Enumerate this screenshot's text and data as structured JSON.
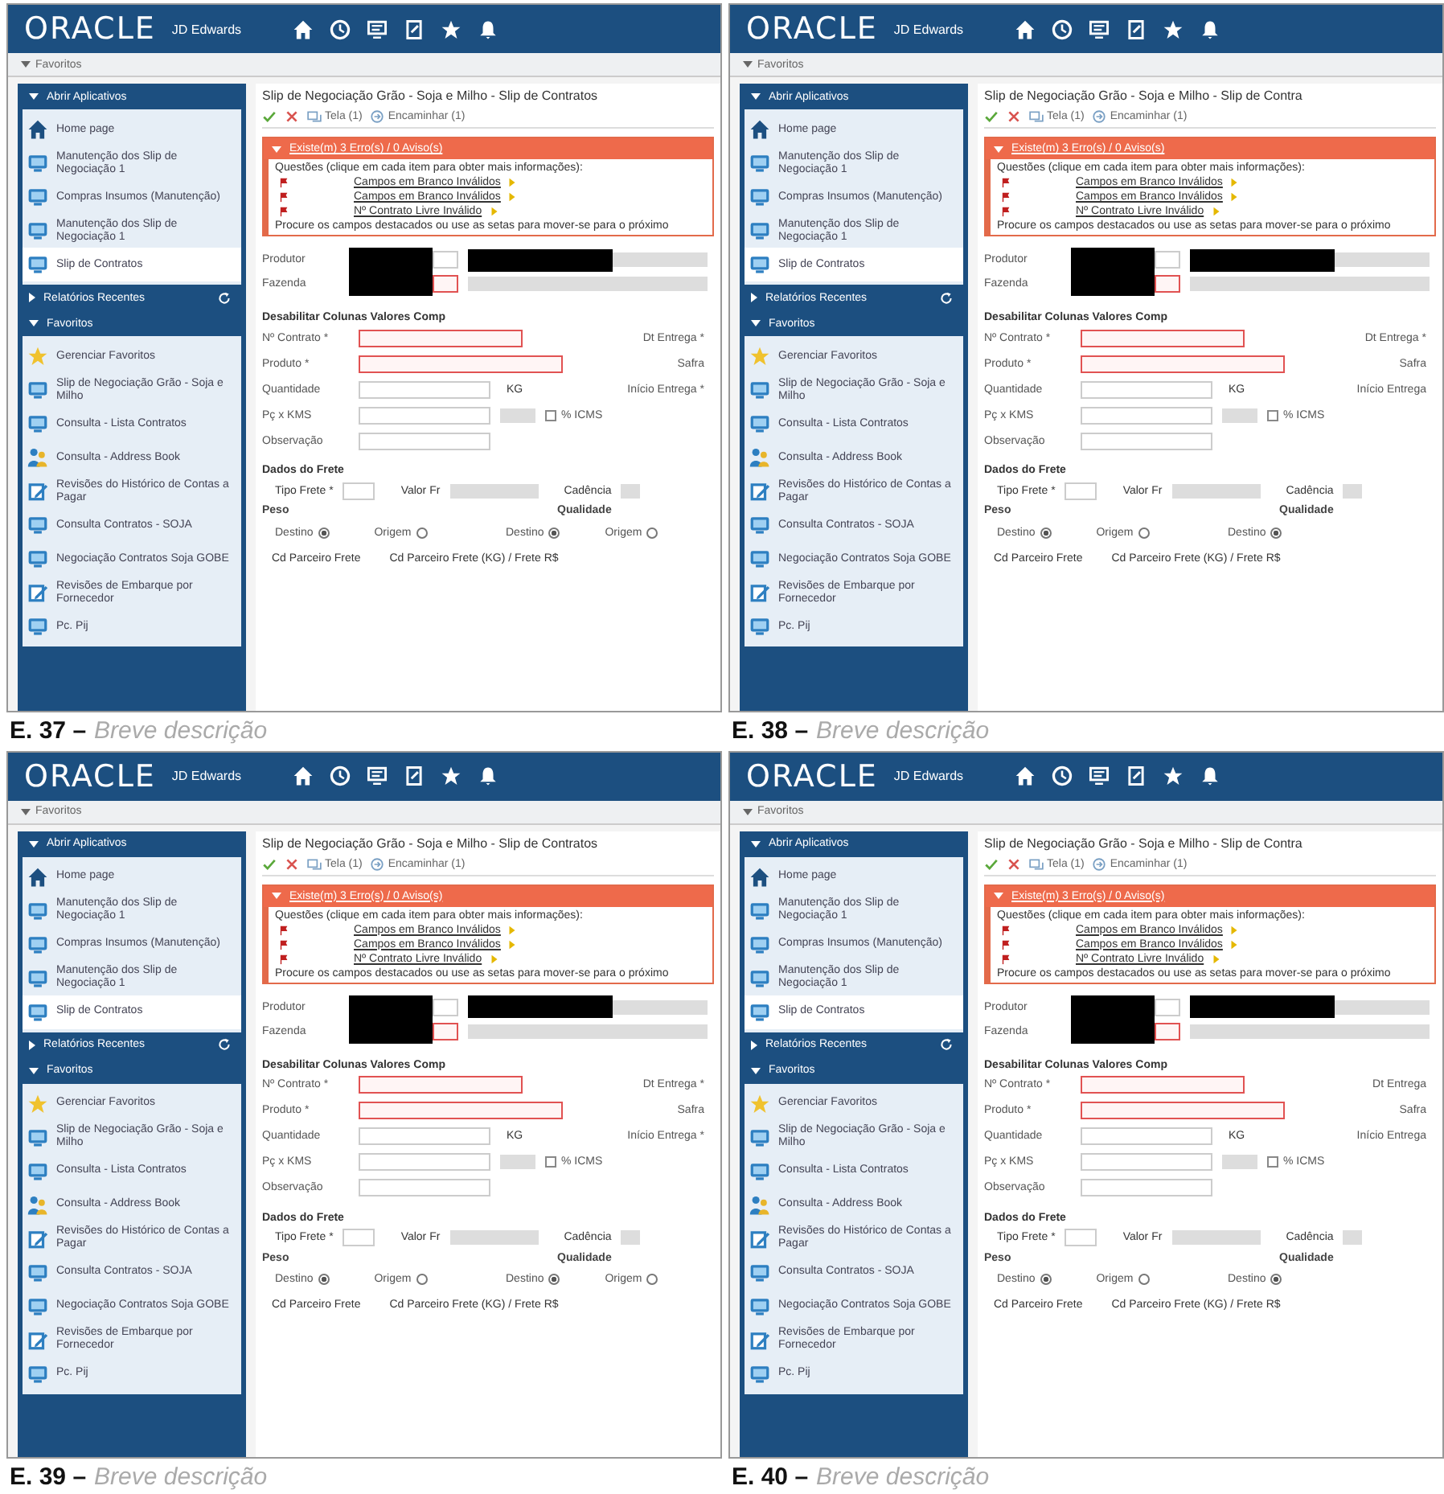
{
  "panels": [
    {
      "caption": {
        "number": "E. 37 –",
        "text": "Breve descrição"
      },
      "header": {
        "brand": "ORACLE",
        "product": "JD Edwards"
      },
      "breadcrumb": "Favoritos",
      "sidebar": [
        {
          "title": "Abrir Aplicativos",
          "expanded": true,
          "items": [
            {
              "kind": "home",
              "label": "Home page",
              "selected": false
            },
            {
              "kind": "monitor",
              "label": "Manutenção dos Slip de Negociação 1",
              "selected": false
            },
            {
              "kind": "monitor",
              "label": "Compras Insumos (Manutenção)",
              "selected": false
            },
            {
              "kind": "monitor",
              "label": "Manutenção dos Slip de Negociação 1",
              "selected": false
            },
            {
              "kind": "monitor",
              "label": "Slip de Contratos",
              "selected": true
            }
          ]
        },
        {
          "title": "Relatórios Recentes",
          "expanded": false
        },
        {
          "title": "Favoritos",
          "expanded": true,
          "items": [
            {
              "kind": "star",
              "label": "Gerenciar Favoritos",
              "selected": false
            },
            {
              "kind": "monitor",
              "label": "Slip de Negociação Grão - Soja e Milho",
              "selected": false
            },
            {
              "kind": "monitor",
              "label": "Consulta - Lista Contratos",
              "selected": false
            },
            {
              "kind": "people",
              "label": "Consulta - Address Book",
              "selected": false
            },
            {
              "kind": "edit",
              "label": "Revisões do Histórico de Contas a Pagar",
              "selected": false
            },
            {
              "kind": "monitor",
              "label": "Consulta Contratos - SOJA",
              "selected": false
            },
            {
              "kind": "monitor",
              "label": "Negociação Contratos Soja GOBE",
              "selected": false
            },
            {
              "kind": "edit",
              "label": "Revisões de Embarque por Fornecedor",
              "selected": false
            },
            {
              "kind": "monitor",
              "label": "Pc. Pij",
              "selected": false
            }
          ]
        }
      ],
      "form": {
        "title": "Slip de Negociação Grão - Soja e Milho - Slip de Contratos",
        "toolbar": [
          {
            "kind": "ok"
          },
          {
            "kind": "cancel"
          },
          {
            "kind": "screen",
            "label": "Tela (1)"
          },
          {
            "kind": "forward",
            "label": "Encaminhar (1)"
          }
        ],
        "alert": {
          "title": "Existe(m) 3 Erro(s) / 0 Aviso(s)",
          "intro": "Questões (clique em cada item para obter mais informações):",
          "issues": [
            "Campos em Branco Inválidos",
            "Campos em Branco Inválidos",
            "Nº Contrato Livre Inválido"
          ],
          "hint": "Procure os campos destacados ou use as setas para mover-se para o próximo"
        },
        "header_fields": [
          "Produtor",
          "Fazenda"
        ],
        "section": {
          "title": "Desabilitar Colunas Valores Comp",
          "rows": [
            {
              "label": "Nº Contrato *",
              "error": true,
              "right_label": "Dt Entrega *"
            },
            {
              "label": "Produto *",
              "error": true,
              "right_label": "Safra"
            },
            {
              "label": "Quantidade",
              "unit": "KG",
              "right_label": "Início Entrega *"
            },
            {
              "label": "Pç x KMS",
              "check_label": "% ICMS",
              "checked": false
            },
            {
              "label": "Observação"
            }
          ]
        },
        "freight": {
          "title": "Dados do Frete",
          "fields": [
            "Tipo Frete *",
            "Valor Fr",
            "Cadência"
          ],
          "groups": [
            {
              "title": "Peso",
              "options": [
                {
                  "label": "Destino",
                  "selected": true
                },
                {
                  "label": "Origem",
                  "selected": false
                }
              ]
            },
            {
              "title": "Qualidade",
              "options": [
                {
                  "label": "Destino",
                  "selected": true
                },
                {
                  "label": "Origem",
                  "selected": false
                }
              ]
            }
          ],
          "partners": [
            "Cd Parceiro Frete",
            "Cd Parceiro Frete (KG) / Frete R$"
          ]
        }
      }
    },
    {
      "caption": {
        "number": "E. 38 –",
        "text": "Breve descrição"
      },
      "header": {
        "brand": "ORACLE",
        "product": "JD Edwards"
      },
      "breadcrumb": "Favoritos",
      "sidebar": [
        {
          "title": "Abrir Aplicativos",
          "expanded": true,
          "items": [
            {
              "kind": "home",
              "label": "Home page",
              "selected": false
            },
            {
              "kind": "monitor",
              "label": "Manutenção dos Slip de Negociação 1",
              "selected": false
            },
            {
              "kind": "monitor",
              "label": "Compras Insumos (Manutenção)",
              "selected": false
            },
            {
              "kind": "monitor",
              "label": "Manutenção dos Slip de Negociação 1",
              "selected": false
            },
            {
              "kind": "monitor",
              "label": "Slip de Contratos",
              "selected": true
            }
          ]
        },
        {
          "title": "Relatórios Recentes",
          "expanded": false
        },
        {
          "title": "Favoritos",
          "expanded": true,
          "items": [
            {
              "kind": "star",
              "label": "Gerenciar Favoritos",
              "selected": false
            },
            {
              "kind": "monitor",
              "label": "Slip de Negociação Grão - Soja e Milho",
              "selected": false
            },
            {
              "kind": "monitor",
              "label": "Consulta - Lista Contratos",
              "selected": false
            },
            {
              "kind": "people",
              "label": "Consulta - Address Book",
              "selected": false
            },
            {
              "kind": "edit",
              "label": "Revisões do Histórico de Contas a Pagar",
              "selected": false
            },
            {
              "kind": "monitor",
              "label": "Consulta Contratos - SOJA",
              "selected": false
            },
            {
              "kind": "monitor",
              "label": "Negociação Contratos Soja GOBE",
              "selected": false
            },
            {
              "kind": "edit",
              "label": "Revisões de Embarque por Fornecedor",
              "selected": false
            },
            {
              "kind": "monitor",
              "label": "Pc. Pij",
              "selected": false
            }
          ]
        }
      ],
      "form": {
        "title": "Slip de Negociação Grão - Soja e Milho - Slip de Contra",
        "toolbar": [
          {
            "kind": "ok"
          },
          {
            "kind": "cancel"
          },
          {
            "kind": "screen",
            "label": "Tela (1)"
          },
          {
            "kind": "forward",
            "label": "Encaminhar (1)"
          }
        ],
        "alert": {
          "title": "Existe(m) 3 Erro(s) / 0 Aviso(s)",
          "intro": "Questões (clique em cada item para obter mais informações):",
          "issues": [
            "Campos em Branco Inválidos",
            "Campos em Branco Inválidos",
            "Nº Contrato Livre Inválido"
          ],
          "hint": "Procure os campos destacados ou use as setas para mover-se para o próximo"
        },
        "header_fields": [
          "Produtor",
          "Fazenda"
        ],
        "section": {
          "title": "Desabilitar Colunas Valores Comp",
          "rows": [
            {
              "label": "Nº Contrato *",
              "error": true,
              "right_label": "Dt Entrega *"
            },
            {
              "label": "Produto *",
              "error": true,
              "right_label": "Safra"
            },
            {
              "label": "Quantidade",
              "unit": "KG",
              "right_label": "Início Entrega"
            },
            {
              "label": "Pç x KMS",
              "check_label": "% ICMS",
              "checked": false
            },
            {
              "label": "Observação"
            }
          ]
        },
        "freight": {
          "title": "Dados do Frete",
          "fields": [
            "Tipo Frete *",
            "Valor Fr",
            "Cadência"
          ],
          "groups": [
            {
              "title": "Peso",
              "options": [
                {
                  "label": "Destino",
                  "selected": true
                },
                {
                  "label": "Origem",
                  "selected": false
                }
              ]
            },
            {
              "title": "Qualidade",
              "options": [
                {
                  "label": "Destino",
                  "selected": true
                }
              ]
            }
          ],
          "partners": [
            "Cd Parceiro Frete",
            "Cd Parceiro Frete (KG) / Frete R$"
          ]
        }
      }
    },
    {
      "caption": {
        "number": "E. 39 –",
        "text": "Breve descrição"
      },
      "header": {
        "brand": "ORACLE",
        "product": "JD Edwards"
      },
      "breadcrumb": "Favoritos",
      "sidebar": [
        {
          "title": "Abrir Aplicativos",
          "expanded": true,
          "items": [
            {
              "kind": "home",
              "label": "Home page",
              "selected": false
            },
            {
              "kind": "monitor",
              "label": "Manutenção dos Slip de Negociação 1",
              "selected": false
            },
            {
              "kind": "monitor",
              "label": "Compras Insumos (Manutenção)",
              "selected": false
            },
            {
              "kind": "monitor",
              "label": "Manutenção dos Slip de Negociação 1",
              "selected": false
            },
            {
              "kind": "monitor",
              "label": "Slip de Contratos",
              "selected": true
            }
          ]
        },
        {
          "title": "Relatórios Recentes",
          "expanded": false
        },
        {
          "title": "Favoritos",
          "expanded": true,
          "items": [
            {
              "kind": "star",
              "label": "Gerenciar Favoritos",
              "selected": false
            },
            {
              "kind": "monitor",
              "label": "Slip de Negociação Grão - Soja e Milho",
              "selected": false
            },
            {
              "kind": "monitor",
              "label": "Consulta - Lista Contratos",
              "selected": false
            },
            {
              "kind": "people",
              "label": "Consulta - Address Book",
              "selected": false
            },
            {
              "kind": "edit",
              "label": "Revisões do Histórico de Contas a Pagar",
              "selected": false
            },
            {
              "kind": "monitor",
              "label": "Consulta Contratos - SOJA",
              "selected": false
            },
            {
              "kind": "monitor",
              "label": "Negociação Contratos Soja GOBE",
              "selected": false
            },
            {
              "kind": "edit",
              "label": "Revisões de Embarque por Fornecedor",
              "selected": false
            },
            {
              "kind": "monitor",
              "label": "Pc. Pij",
              "selected": false
            }
          ]
        }
      ],
      "form": {
        "title": "Slip de Negociação Grão - Soja e Milho - Slip de Contratos",
        "toolbar": [
          {
            "kind": "ok"
          },
          {
            "kind": "cancel"
          },
          {
            "kind": "screen",
            "label": "Tela (1)"
          },
          {
            "kind": "forward",
            "label": "Encaminhar (1)"
          }
        ],
        "alert": {
          "title": "Existe(m) 3 Erro(s) / 0 Aviso(s)",
          "intro": "Questões (clique em cada item para obter mais informações):",
          "issues": [
            "Campos em Branco Inválidos",
            "Campos em Branco Inválidos",
            "Nº Contrato Livre Inválido"
          ],
          "hint": "Procure os campos destacados ou use as setas para mover-se para o próximo"
        },
        "header_fields": [
          "Produtor",
          "Fazenda"
        ],
        "section": {
          "title": "Desabilitar Colunas Valores Comp",
          "rows": [
            {
              "label": "Nº Contrato *",
              "error": true,
              "right_label": "Dt Entrega *"
            },
            {
              "label": "Produto *",
              "error": true,
              "right_label": "Safra"
            },
            {
              "label": "Quantidade",
              "unit": "KG",
              "right_label": "Início Entrega *"
            },
            {
              "label": "Pç x KMS",
              "check_label": "% ICMS",
              "checked": false
            },
            {
              "label": "Observação"
            }
          ]
        },
        "freight": {
          "title": "Dados do Frete",
          "fields": [
            "Tipo Frete *",
            "Valor Fr",
            "Cadência"
          ],
          "groups": [
            {
              "title": "Peso",
              "options": [
                {
                  "label": "Destino",
                  "selected": true
                },
                {
                  "label": "Origem",
                  "selected": false
                }
              ]
            },
            {
              "title": "Qualidade",
              "options": [
                {
                  "label": "Destino",
                  "selected": true
                },
                {
                  "label": "Origem",
                  "selected": false
                }
              ]
            }
          ],
          "partners": [
            "Cd Parceiro Frete",
            "Cd Parceiro Frete (KG) / Frete R$"
          ]
        }
      }
    },
    {
      "caption": {
        "number": "E. 40 –",
        "text": "Breve descrição"
      },
      "header": {
        "brand": "ORACLE",
        "product": "JD Edwards"
      },
      "breadcrumb": "Favoritos",
      "sidebar": [
        {
          "title": "Abrir Aplicativos",
          "expanded": true,
          "items": [
            {
              "kind": "home",
              "label": "Home page",
              "selected": false
            },
            {
              "kind": "monitor",
              "label": "Manutenção dos Slip de Negociação 1",
              "selected": false
            },
            {
              "kind": "monitor",
              "label": "Compras Insumos (Manutenção)",
              "selected": false
            },
            {
              "kind": "monitor",
              "label": "Manutenção dos Slip de Negociação 1",
              "selected": false
            },
            {
              "kind": "monitor",
              "label": "Slip de Contratos",
              "selected": true
            }
          ]
        },
        {
          "title": "Relatórios Recentes",
          "expanded": false
        },
        {
          "title": "Favoritos",
          "expanded": true,
          "items": [
            {
              "kind": "star",
              "label": "Gerenciar Favoritos",
              "selected": false
            },
            {
              "kind": "monitor",
              "label": "Slip de Negociação Grão - Soja e Milho",
              "selected": false
            },
            {
              "kind": "monitor",
              "label": "Consulta - Lista Contratos",
              "selected": false
            },
            {
              "kind": "people",
              "label": "Consulta - Address Book",
              "selected": false
            },
            {
              "kind": "edit",
              "label": "Revisões do Histórico de Contas a Pagar",
              "selected": false
            },
            {
              "kind": "monitor",
              "label": "Consulta Contratos - SOJA",
              "selected": false
            },
            {
              "kind": "monitor",
              "label": "Negociação Contratos Soja GOBE",
              "selected": false
            },
            {
              "kind": "edit",
              "label": "Revisões de Embarque por Fornecedor",
              "selected": false
            },
            {
              "kind": "monitor",
              "label": "Pc. Pij",
              "selected": false
            }
          ]
        }
      ],
      "form": {
        "title": "Slip de Negociação Grão - Soja e Milho - Slip de Contra",
        "toolbar": [
          {
            "kind": "ok"
          },
          {
            "kind": "cancel"
          },
          {
            "kind": "screen",
            "label": "Tela (1)"
          },
          {
            "kind": "forward",
            "label": "Encaminhar (1)"
          }
        ],
        "alert": {
          "title": "Existe(m) 3 Erro(s) / 0 Aviso(s)",
          "intro": "Questões (clique em cada item para obter mais informações):",
          "issues": [
            "Campos em Branco Inválidos",
            "Campos em Branco Inválidos",
            "Nº Contrato Livre Inválido"
          ],
          "hint": "Procure os campos destacados ou use as setas para mover-se para o próximo"
        },
        "header_fields": [
          "Produtor",
          "Fazenda"
        ],
        "section": {
          "title": "Desabilitar Colunas Valores Comp",
          "rows": [
            {
              "label": "Nº Contrato *",
              "error": true,
              "right_label": "Dt Entrega"
            },
            {
              "label": "Produto *",
              "error": true,
              "right_label": "Safra"
            },
            {
              "label": "Quantidade",
              "unit": "KG",
              "right_label": "Início Entrega"
            },
            {
              "label": "Pç x KMS",
              "check_label": "% ICMS",
              "checked": false
            },
            {
              "label": "Observação"
            }
          ]
        },
        "freight": {
          "title": "Dados do Frete",
          "fields": [
            "Tipo Frete *",
            "Valor Fr",
            "Cadência"
          ],
          "groups": [
            {
              "title": "Peso",
              "options": [
                {
                  "label": "Destino",
                  "selected": true
                },
                {
                  "label": "Origem",
                  "selected": false
                }
              ]
            },
            {
              "title": "Qualidade",
              "options": [
                {
                  "label": "Destino",
                  "selected": true
                }
              ]
            }
          ],
          "partners": [
            "Cd Parceiro Frete",
            "Cd Parceiro Frete (KG) / Frete R$"
          ]
        }
      }
    }
  ]
}
